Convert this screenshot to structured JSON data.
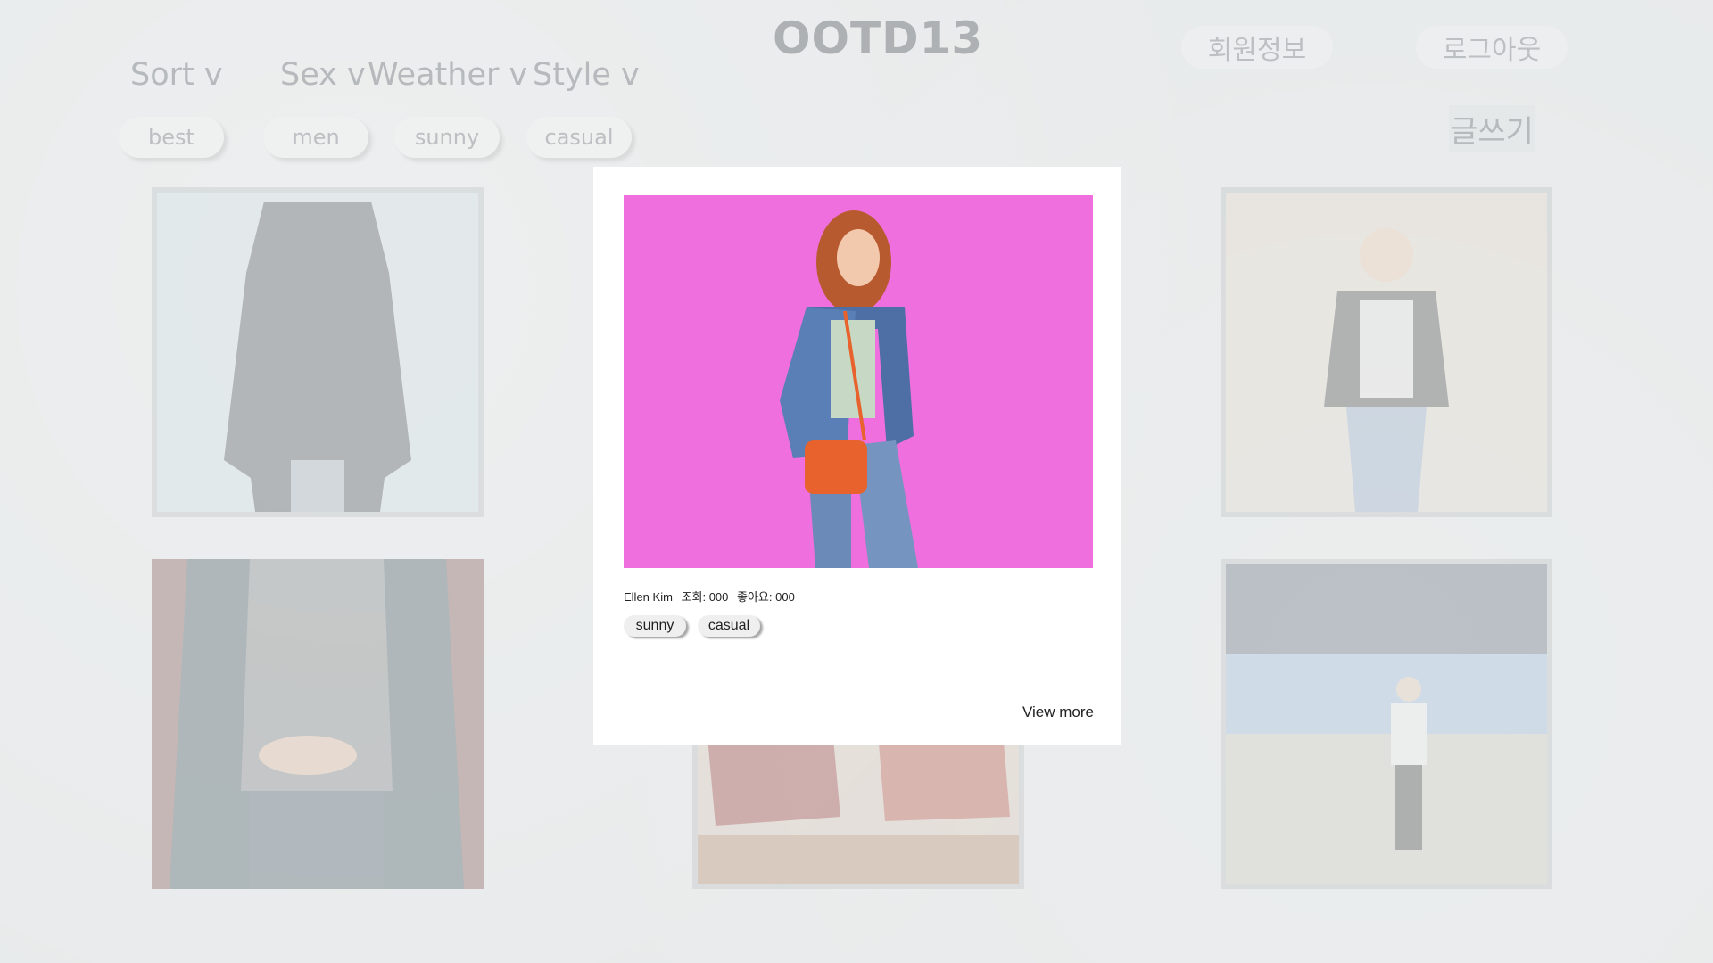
{
  "app": {
    "logo": "OOTD13"
  },
  "filters": {
    "sort": "Sort v",
    "sex": "Sex v",
    "weather": "Weather v",
    "style": "Style v"
  },
  "active_tags": [
    "best",
    "men",
    "sunny",
    "casual"
  ],
  "account": {
    "profile": "회원정보",
    "logout": "로그아웃",
    "write": "글쓰기"
  },
  "modal": {
    "author": "Ellen Kim",
    "views": "조회: 000",
    "likes": "좋아요: 000",
    "tags": [
      "sunny",
      "casual"
    ],
    "view_more": "View more"
  },
  "colors": {
    "modal_image_bg": "#ee6fdd",
    "backdrop": "#e8eaeb"
  }
}
